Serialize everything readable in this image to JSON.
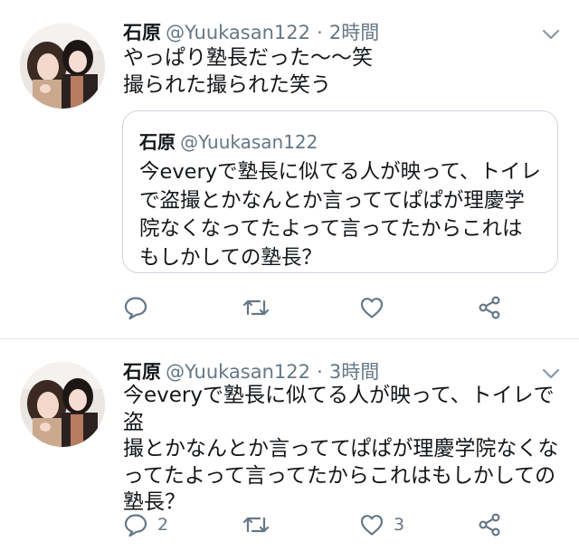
{
  "tweets": [
    {
      "author_name": "石原",
      "handle": "@Yuukasan122",
      "separator": "·",
      "time": "2時間",
      "text": "やっぱり塾長だった〜〜笑\n撮られた撮られた笑う",
      "quoted": {
        "author_name": "石原",
        "handle": "@Yuukasan122",
        "text": "今everyで塾長に似てる人が映って、トイレ\nで盗撮とかなんとか言っててぱぱが理慶学\n院なくなってたよって言ってたからこれは\nもしかしての塾長？"
      },
      "reply_count": "",
      "like_count": ""
    },
    {
      "author_name": "石原",
      "handle": "@Yuukasan122",
      "separator": "·",
      "time": "3時間",
      "text": "今everyで塾長に似てる人が映って、トイレで盗\n撮とかなんとか言っててぱぱが理慶学院なくな\nってたよって言ってたからこれはもしかしての\n塾長？",
      "reply_count": "2",
      "like_count": "3"
    }
  ],
  "icons": {
    "menu": "chevron-down-icon",
    "reply": "reply-icon",
    "retweet": "retweet-icon",
    "like": "heart-icon",
    "share": "share-icon"
  },
  "colors": {
    "text": "#14171a",
    "secondary": "#657786",
    "border": "#ccd6dd",
    "divider": "#e1e8ed"
  }
}
